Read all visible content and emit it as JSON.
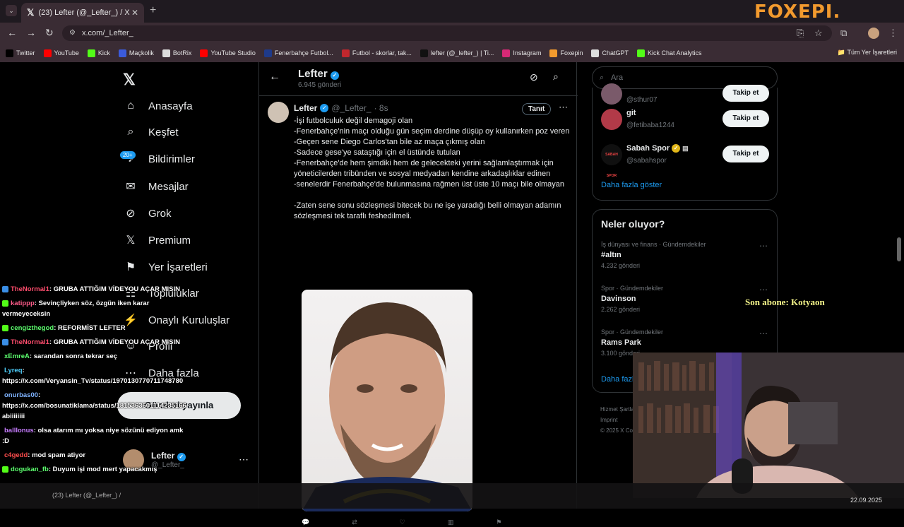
{
  "browser": {
    "tab_title": "(23) Lefter (@_Lefter_) / X",
    "url": "x.com/_Lefter_",
    "logo": "FOXEPI.",
    "all_bookmarks": "Tüm Yer İşaretleri",
    "bookmarks": [
      {
        "label": "Twitter",
        "icon": "x-logo-icon",
        "color": "#000000"
      },
      {
        "label": "YouTube",
        "icon": "youtube-icon",
        "color": "#ff0000"
      },
      {
        "label": "Kick",
        "icon": "kick-icon",
        "color": "#53fc18"
      },
      {
        "label": "Maçkolik",
        "icon": "mackolik-icon",
        "color": "#3b5bdb"
      },
      {
        "label": "BotRix",
        "icon": "botrix-icon",
        "color": "#dddddd"
      },
      {
        "label": "YouTube Studio",
        "icon": "youtube-studio-icon",
        "color": "#ff0000"
      },
      {
        "label": "Fenerbahçe Futbol...",
        "icon": "fenerbahce-icon",
        "color": "#1e3a8a"
      },
      {
        "label": "Futbol - skorlar, tak...",
        "icon": "flashscore-icon",
        "color": "#c0272d"
      },
      {
        "label": "lefter (@_lefter_) | Ti...",
        "icon": "tiktok-icon",
        "color": "#111111"
      },
      {
        "label": "Instagram",
        "icon": "instagram-icon",
        "color": "#d62976"
      },
      {
        "label": "Foxepin",
        "icon": "foxepin-icon",
        "color": "#f29a2e"
      },
      {
        "label": "ChatGPT",
        "icon": "chatgpt-icon",
        "color": "#dddddd"
      },
      {
        "label": "Kick Chat Analytics",
        "icon": "kick-analytics-icon",
        "color": "#53fc18"
      }
    ]
  },
  "nav": {
    "items": [
      {
        "label": "Anasayfa",
        "icon": "home-icon",
        "glyph": "⌂"
      },
      {
        "label": "Keşfet",
        "icon": "search-icon",
        "glyph": "⌕"
      },
      {
        "label": "Bildirimler",
        "icon": "bell-icon",
        "glyph": "♪"
      },
      {
        "label": "Mesajlar",
        "icon": "mail-icon",
        "glyph": "✉"
      },
      {
        "label": "Grok",
        "icon": "grok-icon",
        "glyph": "⊘"
      },
      {
        "label": "Premium",
        "icon": "x-premium-icon",
        "glyph": "𝕏"
      },
      {
        "label": "Yer İşaretleri",
        "icon": "bookmark-icon",
        "glyph": "⚑"
      },
      {
        "label": "Topluluklar",
        "icon": "communities-icon",
        "glyph": "☷"
      },
      {
        "label": "Onaylı Kuruluşlar",
        "icon": "lightning-icon",
        "glyph": "⚡"
      },
      {
        "label": "Profil",
        "icon": "profile-icon",
        "glyph": "☺"
      },
      {
        "label": "Daha fazla",
        "icon": "more-circle-icon",
        "glyph": "⋯"
      }
    ],
    "notif_badge": "20+",
    "post_button": "Gönderi yayınla",
    "account_name": "Lefter",
    "account_handle": "@_Lefter_"
  },
  "profile_header": {
    "name": "Lefter",
    "posts_count": "6.945 gönderi"
  },
  "tweet": {
    "name": "Lefter",
    "handle": "@_Lefter_",
    "time": "· 8s",
    "tanit": "Tanıt",
    "body": "-İşi futbolculuk değil demagoji olan\n-Fenerbahçe'nin maçı olduğu gün seçim derdine düşüp oy kullanırken poz veren\n-Geçen sene Diego Carlos'tan bile az maça çıkmış olan\n-Sadece gese'ye sataştığı için el üstünde tutulan\n-Fenerbahçe'de hem şimdiki hem de gelecekteki yerini sağlamlaştırmak için yöneticilerden tribünden ve sosyal medyadan kendine arkadaşlıklar edinen\n-senelerdir Fenerbahçe'de bulunmasına rağmen üst üste 10 maçı bile olmayan\n\n-Zaten sene sonu sözleşmesi bitecek bu ne işe yaradığı belli olmayan adamın sözleşmesi tek taraflı feshedilmeli."
  },
  "right": {
    "search_placeholder": "Ara",
    "partial_handle": "@sthur07",
    "partial_button": "Takip et",
    "who_to_follow": [
      {
        "name": "git",
        "handle": "@fetibaba1244",
        "button": "Takip et",
        "verified": false,
        "avatar_color": "#b23a48"
      },
      {
        "name": "Sabah Spor",
        "handle": "@sabahspor",
        "button": "Takip et",
        "verified": true,
        "avatar_color": "#101010",
        "avatar_text": "SABAH SPOR"
      }
    ],
    "show_more": "Daha fazla göster",
    "trends_title": "Neler oluyor?",
    "trends": [
      {
        "category": "İş dünyası ve finans · Gündemdekiler",
        "title": "#altın",
        "count": "4.232 gönderi"
      },
      {
        "category": "Spor · Gündemdekiler",
        "title": "Davinson",
        "count": "2.262 gönderi"
      },
      {
        "category": "Spor · Gündemdekiler",
        "title": "Rams Park",
        "count": "3.100 gönderi"
      }
    ],
    "trends_more": "Daha fazla göster",
    "footer": [
      "Hizmet Şartları",
      "Imprint",
      "© 2025 X Corp."
    ]
  },
  "stream": {
    "new_sub": "Son abone: Kotyaon",
    "chat": [
      {
        "user": "TheNormal1",
        "color": "#ff4d6d",
        "msg": ": GRUBA ATTIĞIM VİDEYOU AÇAR MISIN",
        "badge": "#3a8ee6"
      },
      {
        "user": "katippp",
        "color": "#ff5c8a",
        "msg": ": Sevinçliyken söz, özgün iken karar vermeyeceksin",
        "badge": "#53fc18"
      },
      {
        "user": "cengizthegod",
        "color": "#5cff6e",
        "msg": ": REFORMİST LEFTER",
        "badge": "#53fc18"
      },
      {
        "user": "TheNormal1",
        "color": "#ff4d6d",
        "msg": ": GRUBA ATTIĞIM VİDEYOU AÇAR MISIN",
        "badge": "#3a8ee6"
      },
      {
        "user": "xEmreA",
        "color": "#5cff6e",
        "msg": ": sarandan sonra tekrar seç",
        "badge": ""
      },
      {
        "user": "Lyreq",
        "color": "#4fd1ff",
        "msg": ": https://x.com/Veryansin_Tv/status/1970130770711748780",
        "badge": ""
      },
      {
        "user": "onurbas00",
        "color": "#7fb3ff",
        "msg": ": https://x.com/bosunatiklama/status/1815363601114235166 abiiiiiiii",
        "badge": ""
      },
      {
        "user": "balllonus",
        "color": "#c77dff",
        "msg": ": olsa atarım mı yoksa niye sözünü ediyon amk :D",
        "badge": ""
      },
      {
        "user": "c4gedd",
        "color": "#ff4d4d",
        "msg": ": mod spam atiyor",
        "badge": ""
      },
      {
        "user": "dogukan_fb",
        "color": "#5cff6e",
        "msg": ": Duyum işi mod mert yapacakmış",
        "badge": "#53fc18"
      }
    ],
    "taskbar_title": "(23) Lefter (@_Lefter_) /",
    "date": "22.09.2025"
  }
}
